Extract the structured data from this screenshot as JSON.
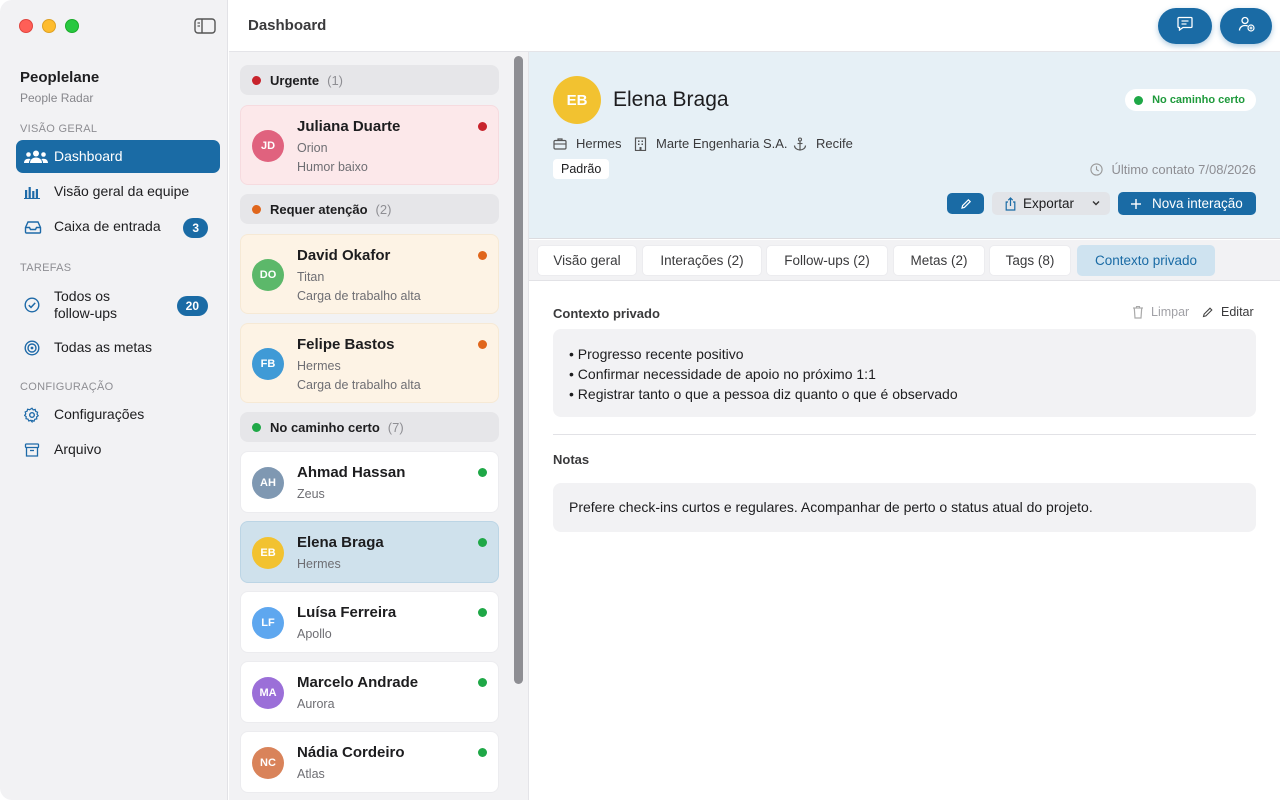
{
  "sidebar": {
    "app_name": "Peoplelane",
    "app_subtitle": "People Radar",
    "sections": {
      "overview": "VISÃO GERAL",
      "tasks": "TAREFAS",
      "config": "CONFIGURAÇÃO"
    },
    "items": {
      "dashboard": "Dashboard",
      "team_overview": "Visão geral da equipe",
      "inbox": "Caixa de entrada",
      "inbox_count": "3",
      "followups_line1": "Todos os",
      "followups_line2": "follow-ups",
      "followups_count": "20",
      "goals": "Todas as metas",
      "settings": "Configurações",
      "archive": "Arquivo"
    }
  },
  "topbar": {
    "title": "Dashboard"
  },
  "list": {
    "groups": {
      "urgent": {
        "label": "Urgente",
        "count": "(1)"
      },
      "attention": {
        "label": "Requer atenção",
        "count": "(2)"
      },
      "ontrack": {
        "label": "No caminho certo",
        "count": "(7)"
      }
    },
    "people": [
      {
        "initials": "JD",
        "name": "Juliana Duarte",
        "team": "Orion",
        "note": "Humor baixo"
      },
      {
        "initials": "DO",
        "name": "David Okafor",
        "team": "Titan",
        "note": "Carga de trabalho alta"
      },
      {
        "initials": "FB",
        "name": "Felipe Bastos",
        "team": "Hermes",
        "note": "Carga de trabalho alta"
      },
      {
        "initials": "AH",
        "name": "Ahmad Hassan",
        "team": "Zeus"
      },
      {
        "initials": "EB",
        "name": "Elena Braga",
        "team": "Hermes"
      },
      {
        "initials": "LF",
        "name": "Luísa Ferreira",
        "team": "Apollo"
      },
      {
        "initials": "MA",
        "name": "Marcelo Andrade",
        "team": "Aurora"
      },
      {
        "initials": "NC",
        "name": "Nádia Cordeiro",
        "team": "Atlas"
      }
    ]
  },
  "colors": {
    "accent": "#1a6ba5",
    "urgent": "#c8232c",
    "attention": "#e0661c",
    "ontrack": "#1fa847"
  },
  "detail": {
    "initials": "EB",
    "name": "Elena Braga",
    "status": "No caminho certo",
    "team": "Hermes",
    "company": "Marte Engenharia S.A.",
    "city": "Recife",
    "tag": "Padrão",
    "last_contact": "Último contato 7/08/2026",
    "export_label": "Exportar",
    "new_interaction_label": "Nova interação",
    "tabs": [
      "Visão geral",
      "Interações (2)",
      "Follow-ups (2)",
      "Metas (2)",
      "Tags (8)",
      "Contexto privado"
    ],
    "private_context": {
      "title": "Contexto privado",
      "clear_label": "Limpar",
      "edit_label": "Editar",
      "lines": [
        "• Progresso recente positivo",
        "• Confirmar necessidade de apoio no próximo 1:1",
        "• Registrar tanto o que a pessoa diz quanto o que é observado"
      ]
    },
    "notes": {
      "title": "Notas",
      "text": "Prefere check-ins curtos e regulares. Acompanhar de perto o status atual do projeto."
    }
  }
}
